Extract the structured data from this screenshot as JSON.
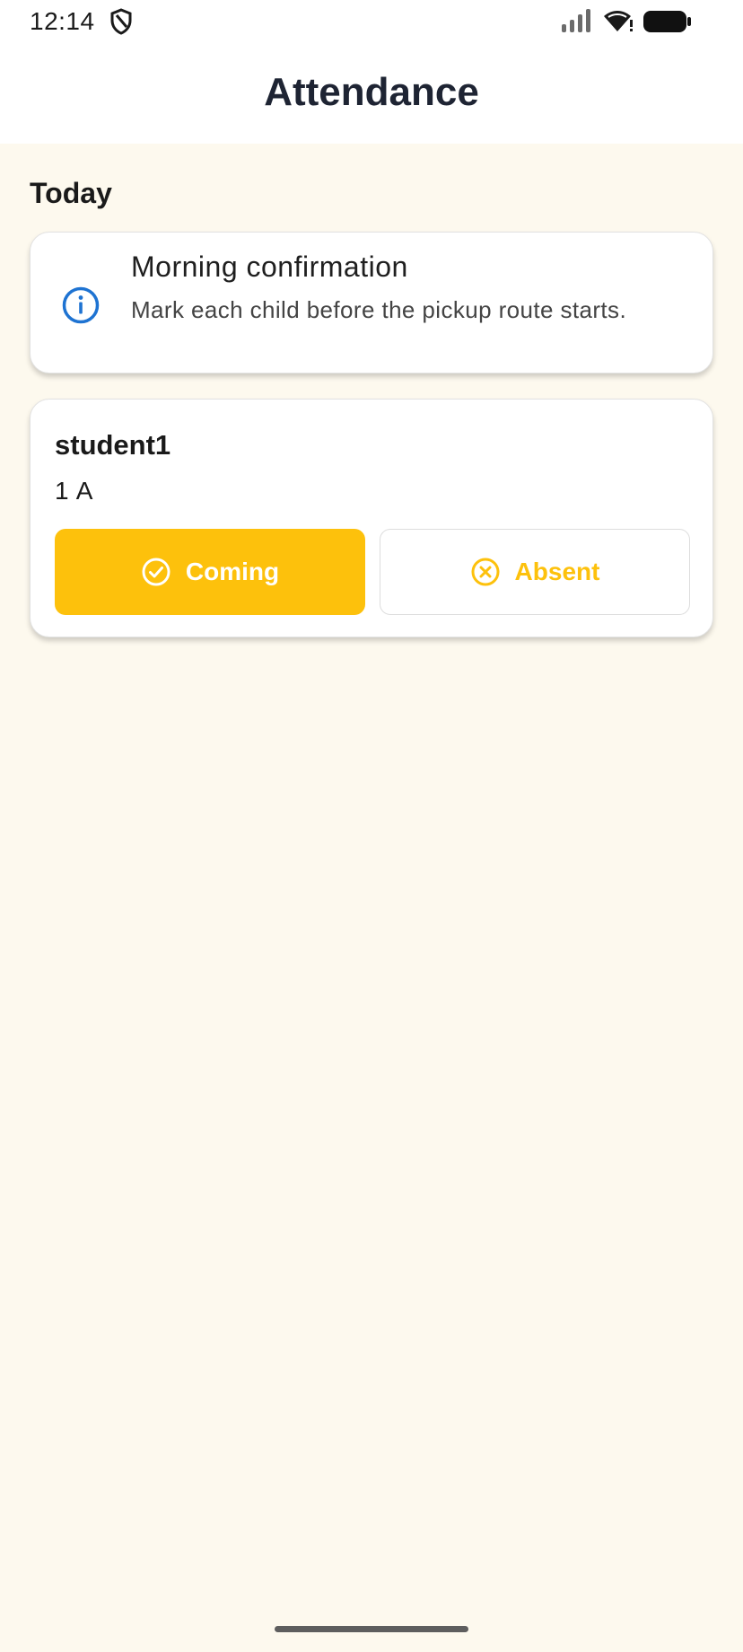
{
  "status_bar": {
    "time": "12:14",
    "icons": [
      "shield-icon",
      "signal-icon",
      "wifi-icon",
      "battery-icon"
    ]
  },
  "app_bar": {
    "title": "Attendance"
  },
  "section": {
    "title": "Today"
  },
  "info_card": {
    "icon": "info-icon",
    "title": "Morning confirmation",
    "text": "Mark each child before the pickup route starts."
  },
  "student_card": {
    "name": "student1",
    "class": "1 A",
    "coming_label": "Coming",
    "absent_label": "Absent"
  },
  "colors": {
    "accent": "#FDC10C",
    "background": "#FDF9EE",
    "info_icon": "#1E73D2",
    "title_text": "#1E2433"
  }
}
